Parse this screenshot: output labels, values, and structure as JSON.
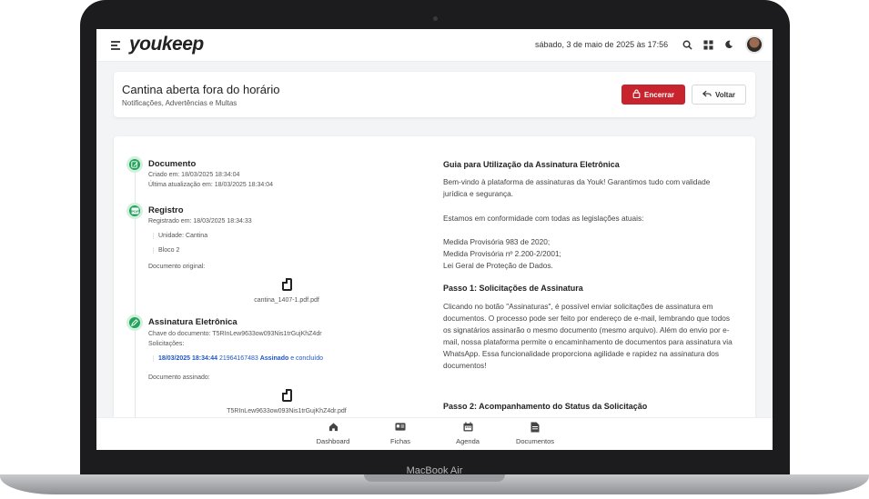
{
  "device_label": "MacBook Air",
  "topbar": {
    "logo": "youkeep",
    "datetime": "sábado, 3 de maio de 2025 às 17:56",
    "icons": [
      "menu-icon",
      "search-icon",
      "grid-icon",
      "moon-icon",
      "avatar"
    ]
  },
  "header": {
    "title": "Cantina aberta fora do horário",
    "subtitle": "Notificações, Advertências e Multas",
    "encerrar_label": "Encerrar",
    "voltar_label": "Voltar",
    "accent": "#c8242e"
  },
  "timeline": {
    "documento": {
      "title": "Documento",
      "created": "Criado em: 18/03/2025 18:34:04",
      "updated": "Última atualização em: 18/03/2025 18:34:04"
    },
    "registro": {
      "title": "Registro",
      "registered": "Registrado em: 18/03/2025 18:34:33",
      "unidade": "Unidade: Cantina",
      "bloco": "Bloco 2",
      "original_label": "Documento original:",
      "original_file": "cantina_1407-1.pdf.pdf"
    },
    "assinatura": {
      "title": "Assinatura Eletrônica",
      "key": "Chave do documento: T5RInLew9633ow093Nis1trGujKhZ4dr",
      "requests_label": "Solicitações:",
      "request": {
        "date": "18/03/2025 18:34:44",
        "phone": "21964167483",
        "status": "Assinado",
        "extra": "e concluído"
      },
      "signed_label": "Documento assinado:",
      "signed_file": "T5RInLew9633ow093Nis1trGujKhZ4dr.pdf"
    }
  },
  "guide": {
    "title": "Guia para Utilização da Assinatura Eletrônica",
    "intro": "Bem-vindo à plataforma de assinaturas da Youk! Garantimos tudo com validade jurídica e segurança.",
    "compliance": "Estamos em conformidade com todas as legislações atuais:",
    "laws": [
      "Medida Provisória 983 de 2020;",
      "Medida Provisória nº 2.200-2/2001;",
      "Lei Geral de Proteção de Dados."
    ],
    "step1_title": "Passo 1: Solicitações de Assinatura",
    "step1_text": "Clicando no botão \"Assinaturas\", é possível enviar solicitações de assinatura em documentos. O processo pode ser feito por endereço de e-mail, lembrando que todos os signatários assinarão o mesmo documento (mesmo arquivo). Além do envio por e-mail, nossa plataforma permite o encaminhamento de documentos para assinatura via WhatsApp. Essa funcionalidade proporciona agilidade e rapidez na assinatura dos documentos!",
    "step2_title": "Passo 2: Acompanhamento do Status da Solicitação"
  },
  "bottomnav": {
    "items": [
      {
        "label": "Dashboard",
        "icon": "home-icon"
      },
      {
        "label": "Fichas",
        "icon": "id-card-icon"
      },
      {
        "label": "Agenda",
        "icon": "calendar-icon"
      },
      {
        "label": "Documentos",
        "icon": "document-icon"
      }
    ]
  }
}
